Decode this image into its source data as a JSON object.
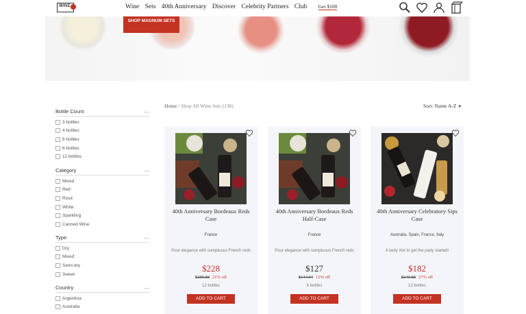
{
  "header": {
    "logo_text": "WINE",
    "nav": [
      "Wine",
      "Sets",
      "40th Anniversary",
      "Discover",
      "Celebrity Partners",
      "Club"
    ],
    "gift_link": "Get $100",
    "icons": [
      "search-icon",
      "heart-icon",
      "account-icon",
      "cart-icon"
    ]
  },
  "hero": {
    "button_label": "SHOP MAGNUM SETS"
  },
  "sidebar": {
    "groups": [
      {
        "title": "Bottle Count",
        "options": [
          "3 bottles",
          "4 bottles",
          "6 bottles",
          "8 bottles",
          "12 bottles"
        ]
      },
      {
        "title": "Category",
        "options": [
          "Mixed",
          "Red",
          "Rosé",
          "White",
          "Sparkling",
          "Canned Wine"
        ]
      },
      {
        "title": "Type",
        "options": [
          "Dry",
          "Mixed",
          "Semi-dry",
          "Sweet"
        ]
      },
      {
        "title": "Country",
        "options": [
          "Argentina",
          "Australia"
        ]
      }
    ]
  },
  "breadcrumb": {
    "home": "Home",
    "sep": "/",
    "current": "Shop All Wine Sets (136)"
  },
  "sort": {
    "label": "Sort: Name A-Z"
  },
  "colors": {
    "accent": "#c33222",
    "card_bg": "#f4f5fa"
  },
  "products": [
    {
      "name": "40th Anniversary Bordeaux Reds Case",
      "origin": "France",
      "desc": "Pour elegance with sumptuous French reds",
      "price": "$228",
      "orig_price": "$289.88",
      "discount": "21% off",
      "qty": "12 bottles",
      "cta": "ADD TO CART"
    },
    {
      "name": "40th Anniversary Bordeaux Reds Half-Case",
      "origin": "France",
      "desc": "Pour elegance with sumptuous French reds",
      "price": "$127",
      "orig_price": "$144.94",
      "discount": "12% off",
      "qty": "6 bottles",
      "cta": "ADD TO CART"
    },
    {
      "name": "40th Anniversary Celebratory Sips Case",
      "origin": "Australia, Spain, France, Italy",
      "desc": "A tasty mix to get the party started!",
      "price": "$182",
      "orig_price": "$249.88",
      "discount": "27% off",
      "qty": "12 bottles",
      "cta": "ADD TO CART"
    }
  ]
}
